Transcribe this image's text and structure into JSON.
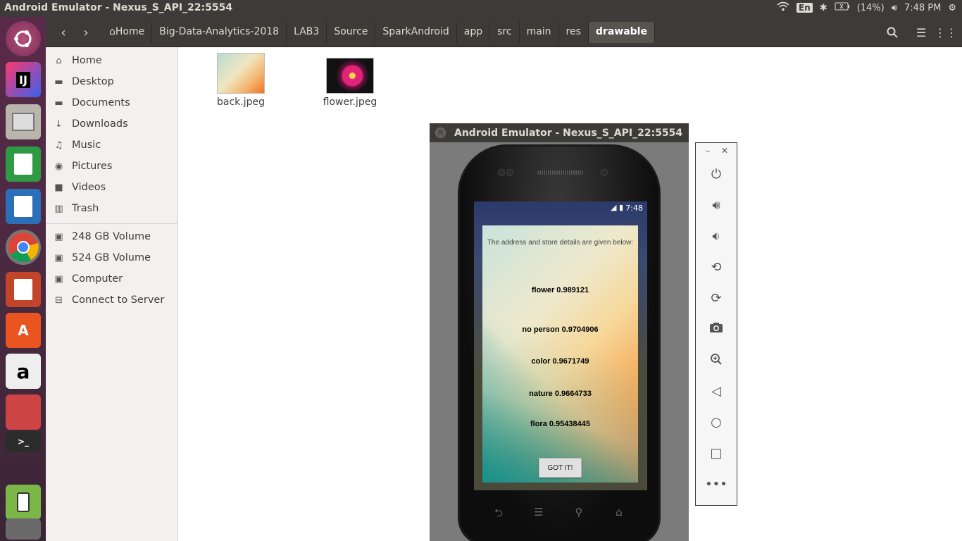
{
  "topbar": {
    "title": "Android Emulator - Nexus_S_API_22:5554",
    "keyboard": "En",
    "battery": "(14%)",
    "time": "7:48 PM"
  },
  "nav": {
    "crumbs": [
      "Home",
      "Big-Data-Analytics-2018",
      "LAB3",
      "Source",
      "SparkAndroid",
      "app",
      "src",
      "main",
      "res",
      "drawable"
    ]
  },
  "sidebar": {
    "items": [
      {
        "label": "Home",
        "icon": "home-icon"
      },
      {
        "label": "Desktop",
        "icon": "folder-icon"
      },
      {
        "label": "Documents",
        "icon": "folder-icon"
      },
      {
        "label": "Downloads",
        "icon": "download-icon"
      },
      {
        "label": "Music",
        "icon": "music-icon"
      },
      {
        "label": "Pictures",
        "icon": "camera-icon"
      },
      {
        "label": "Videos",
        "icon": "video-icon"
      },
      {
        "label": "Trash",
        "icon": "trash-icon"
      },
      {
        "label": "248 GB Volume",
        "icon": "drive-icon"
      },
      {
        "label": "524 GB Volume",
        "icon": "drive-icon"
      },
      {
        "label": "Computer",
        "icon": "drive-icon"
      },
      {
        "label": "Connect to Server",
        "icon": "network-icon"
      }
    ]
  },
  "files": [
    {
      "name": "back.jpeg"
    },
    {
      "name": "flower.jpeg"
    }
  ],
  "emulator": {
    "title": "Android Emulator - Nexus_S_API_22:5554",
    "status_time": "7:48",
    "dialog": {
      "message": "The address and store details are given below:",
      "results": [
        "flower  0.989121",
        "no person  0.9704906",
        "color 0.9671749",
        "nature  0.9664733",
        "flora  0.95438445"
      ],
      "button": "GOT IT!"
    }
  }
}
